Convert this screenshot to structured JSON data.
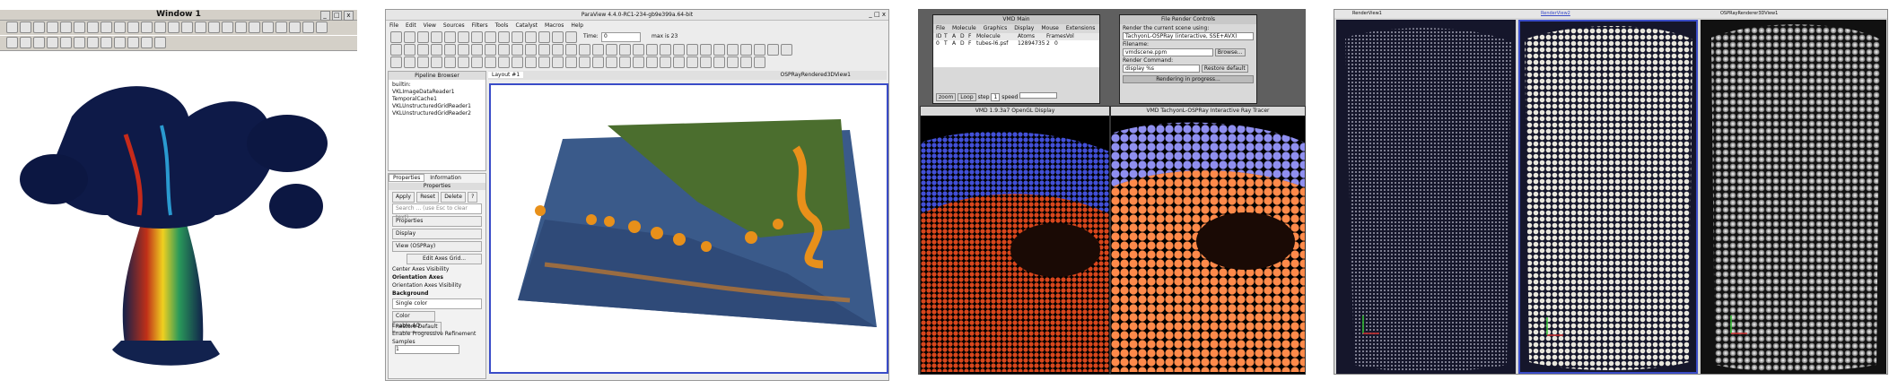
{
  "colors": {
    "accent": "#3a4cc8",
    "vmd_bg": "#000000",
    "ospray_blue": "#8f8ff0",
    "ospray_orange": "#ff8a4a"
  },
  "win1": {
    "title": "Window 1",
    "controls": [
      "_",
      "□",
      "x"
    ]
  },
  "paraview": {
    "title": "ParaView 4.4.0-RC1-234-gb9e399a.64-bit",
    "menu": [
      "File",
      "Edit",
      "View",
      "Sources",
      "Filters",
      "Tools",
      "Catalyst",
      "Macros",
      "Help"
    ],
    "time_label": "Time:",
    "time_value": "0",
    "time_max": "max is 23",
    "pipeline": {
      "title": "Pipeline Browser",
      "items": [
        "builtin:",
        "VKLImageDataReader1",
        "TemporalCache1",
        "VKLUnstructuredGridReader1",
        "VKLUnstructuredGridReader2"
      ]
    },
    "tabs": {
      "properties": "Properties",
      "information": "Information"
    },
    "prop_header": "Properties",
    "prop_buttons": [
      "Apply",
      "Reset",
      "Delete",
      "?"
    ],
    "search_placeholder": "Search ... (use Esc to clear text)",
    "sections": {
      "properties": "Properties",
      "display": "Display",
      "view": "View (OSPRay)"
    },
    "edit_grid": "Edit Axes Grid...",
    "center_axes": "Center Axes Visibility",
    "orientation_axes": "Orientation Axes",
    "orientation_vis": "Orientation Axes Visibility",
    "background": "Background",
    "bg_mode": "Single color",
    "color_label": "Color",
    "restore_default": "Restore Default",
    "enable_ao": "Enable AO",
    "enable_prog": "Enable Progressive Refinement",
    "samples_label": "Samples",
    "samples_value": "1",
    "layout_tab": "Layout #1",
    "view_name": "OSPRayRendered3DView1"
  },
  "vmd_main": {
    "title": "VMD Main",
    "menu": [
      "File",
      "Molecule",
      "Graphics",
      "Display",
      "Mouse",
      "Extensions",
      "Help"
    ],
    "headers": [
      "ID",
      "T",
      "A",
      "D",
      "F",
      "Molecule",
      "Atoms",
      "Frames",
      "Vol"
    ],
    "row": [
      "0",
      "T",
      "A",
      "D",
      "F",
      "tubes-l6.psf",
      "12894735",
      "2",
      "0"
    ],
    "zoom": "zoom",
    "loop": "Loop",
    "step_label": "step",
    "step_value": "1",
    "speed_label": "speed"
  },
  "render_controls": {
    "title": "File Render Controls",
    "scene_label": "Render the current scene using:",
    "renderer": "TachyonL-OSPRay (interactive, SSE+AVX)",
    "filename_label": "Filename:",
    "filename": "vmdscene.ppm",
    "browse": "Browse...",
    "command_label": "Render Command:",
    "command": "display %s",
    "restore": "Restore default",
    "status": "Rendering in progress..."
  },
  "vmd_display": {
    "title": "VMD 1.9.3a7 OpenGL Display"
  },
  "vmd_ospray": {
    "title": "VMD TachyonL-OSPRay Interactive Ray Tracer"
  },
  "rv": {
    "view1": "RenderView1",
    "view2": "RenderView2",
    "view3": "OSPRayRenderer3DView1"
  }
}
